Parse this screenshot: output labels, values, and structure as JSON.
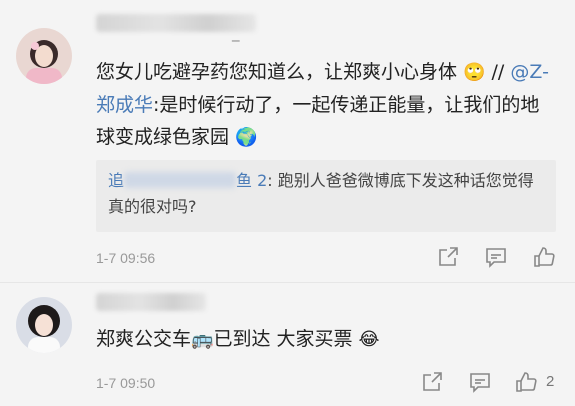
{
  "comments": [
    {
      "text_before": "您女儿吃避孕药您知道么，让郑爽小心身体",
      "emoji_1": "🙄",
      "text_after": "//",
      "mention": "@Z-郑成华",
      "text_rest": ":是时候行动了，一起传递正能量，让我们的地球变成绿色家园",
      "emoji_2": "🌍",
      "reply": {
        "user_visible": "追",
        "user_tail": "鱼 2",
        "text": ": 跑别人爸爸微博底下发这种话您觉得真的很对吗?"
      },
      "timestamp": "1-7 09:56",
      "username_tail": "_"
    },
    {
      "text_before": "郑爽公交车",
      "emoji_1": "🚌",
      "text_mid": "已到达 大家买票",
      "emoji_2": "😂",
      "timestamp": "1-7 09:50",
      "like_count": "2"
    }
  ],
  "icons": {
    "share": "share-icon",
    "comment": "comment-icon",
    "like": "thumbs-up-icon"
  },
  "colors": {
    "link": "#4a7bb7",
    "meta": "#999999",
    "background": "#f4f4f4"
  }
}
